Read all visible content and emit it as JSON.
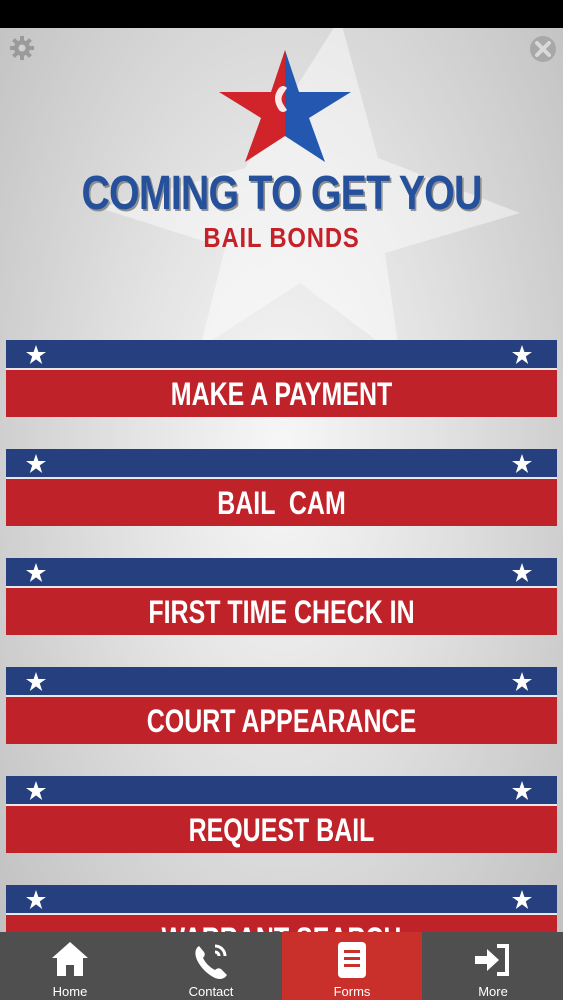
{
  "logo": {
    "title": "COMING TO GET YOU",
    "subtitle": "BAIL BONDS"
  },
  "menu": {
    "items": [
      {
        "label": "MAKE A PAYMENT"
      },
      {
        "label": "BAIL  CAM"
      },
      {
        "label": "FIRST TIME CHECK IN"
      },
      {
        "label": "COURT APPEARANCE"
      },
      {
        "label": "REQUEST BAIL"
      },
      {
        "label": "WARRANT SEARCH"
      }
    ]
  },
  "tabs": [
    {
      "label": "Home",
      "icon": "home-icon",
      "active": false
    },
    {
      "label": "Contact",
      "icon": "phone-icon",
      "active": false
    },
    {
      "label": "Forms",
      "icon": "forms-icon",
      "active": true
    },
    {
      "label": "More",
      "icon": "sign-in-icon",
      "active": false
    }
  ],
  "colors": {
    "blue": "#253f7f",
    "red": "#c0222a",
    "tab_bar": "#4f4f4f",
    "tab_active": "#c9302c"
  }
}
